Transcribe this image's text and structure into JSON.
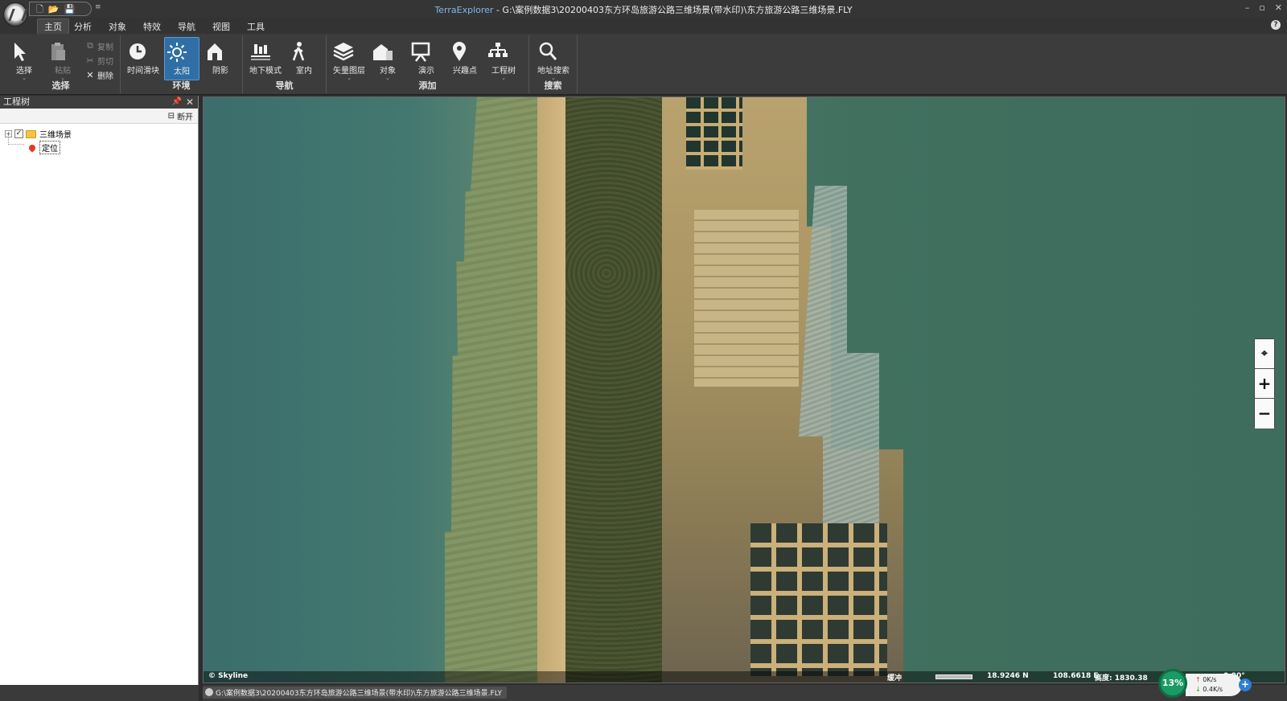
{
  "titlebar": {
    "app_name": "TerraExplorer",
    "title_path": " - G:\\案例数据3\\20200403东方环岛旅游公路三维场景(带水印)\\东方旅游公路三维场景.FLY",
    "qat_more": "≡"
  },
  "menu": {
    "tabs": [
      "主页",
      "分析",
      "对象",
      "特效",
      "导航",
      "视图",
      "工具"
    ],
    "active": "主页"
  },
  "ribbon": {
    "groups": [
      {
        "label": "选择"
      },
      {
        "label": "环境"
      },
      {
        "label": "导航"
      },
      {
        "label": "添加"
      },
      {
        "label": "搜索"
      }
    ],
    "select": {
      "label": "选择"
    },
    "paste": {
      "label": "粘贴"
    },
    "copy": {
      "label": "复制"
    },
    "cut": {
      "label": "剪切"
    },
    "delete": {
      "label": "删除"
    },
    "time_slider": {
      "label": "时间滑块"
    },
    "sun": {
      "label": "太阳"
    },
    "shadow": {
      "label": "阴影"
    },
    "underground": {
      "label": "地下模式"
    },
    "indoor": {
      "label": "室内"
    },
    "vector_layer": {
      "label": "矢量图层"
    },
    "object": {
      "label": "对象"
    },
    "presentation": {
      "label": "演示"
    },
    "poi": {
      "label": "兴趣点"
    },
    "project_tree": {
      "label": "工程树"
    },
    "address_search": {
      "label": "地址搜索"
    }
  },
  "panel": {
    "title": "工程树",
    "disconnect": "断开",
    "tree": [
      {
        "label": "三维场景",
        "checked": true
      },
      {
        "label": "定位"
      }
    ]
  },
  "viewport": {
    "logo": "© Skyline",
    "buffer": "缓冲",
    "lat": "18.9246 N",
    "lon": "108.6618 E",
    "altitude": "高度: 1830.38",
    "pitch": "0.00°"
  },
  "status": {
    "path": "G:\\案例数据3\\20200403东方环岛旅游公路三维场景(带水印)\\东方旅游公路三维场景.FLY"
  },
  "perf": {
    "cpu": "13%",
    "up": "0K/s",
    "down": "0.4K/s"
  },
  "icons": {
    "accent": "#2f6fa6"
  }
}
